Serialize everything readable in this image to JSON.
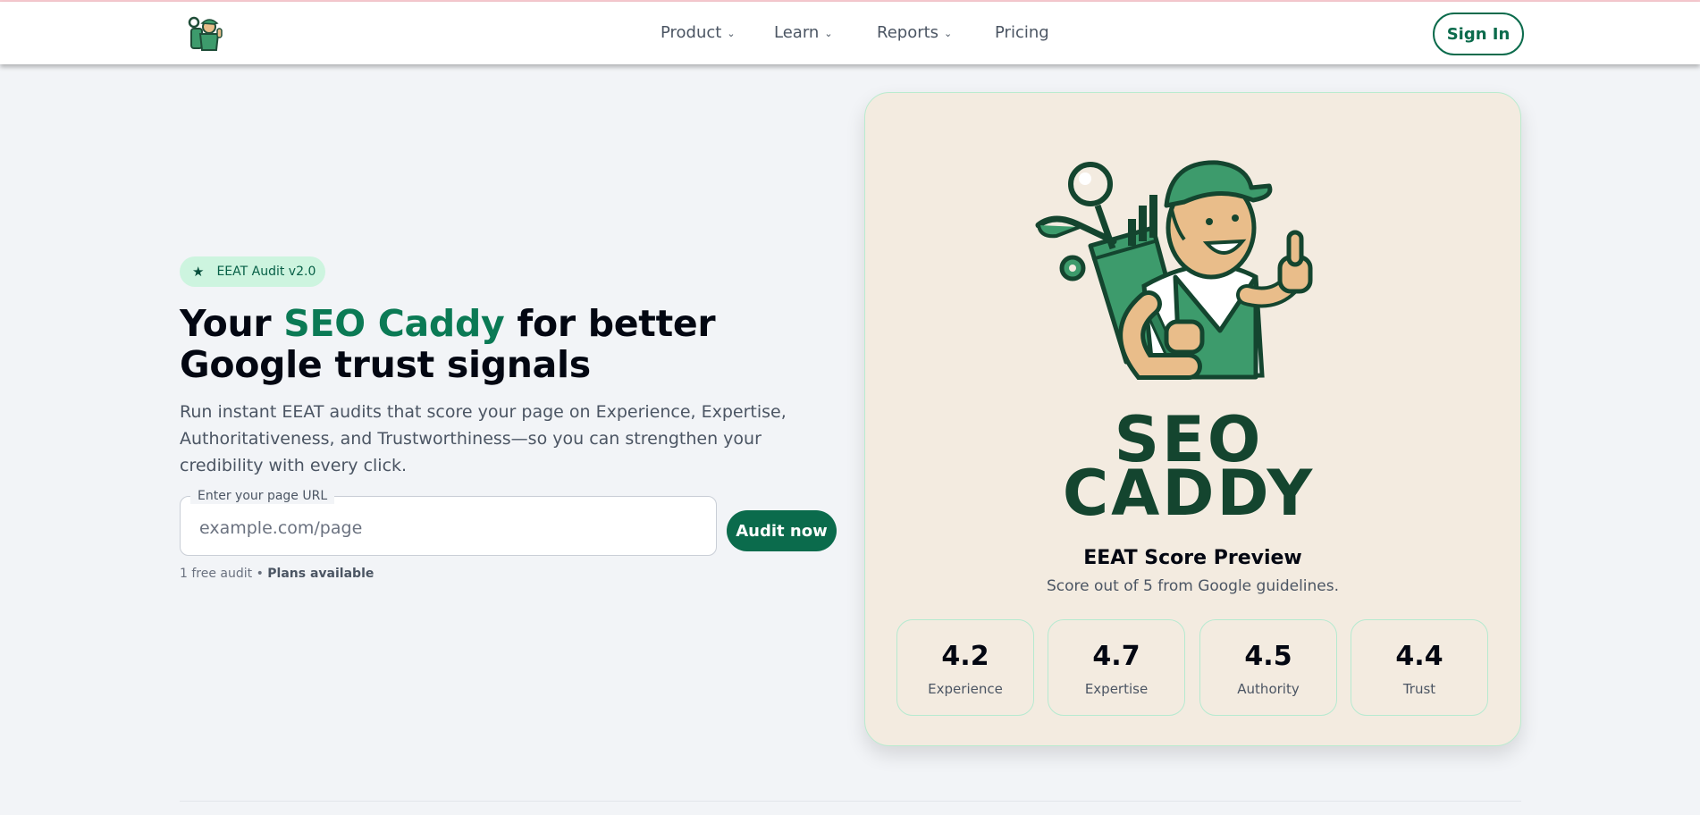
{
  "nav": {
    "items": [
      {
        "label": "Product",
        "has_dropdown": true
      },
      {
        "label": "Learn",
        "has_dropdown": true
      },
      {
        "label": "Reports",
        "has_dropdown": true
      },
      {
        "label": "Pricing",
        "has_dropdown": false
      }
    ],
    "sign_in": "Sign In"
  },
  "hero": {
    "badge": "EEAT Audit v2.0",
    "headline_pre": "Your ",
    "headline_accent": "SEO Caddy",
    "headline_post": " for better Google trust signals",
    "description": "Run instant EEAT audits that score your page on Experience, Expertise, Authoritativeness, and Trustworthiness—so you can strengthen your credibility with every click.",
    "url_label": "Enter your page URL",
    "url_placeholder": "example.com/page",
    "audit_button": "Audit now",
    "note_plain": "1 free audit • ",
    "note_bold": "Plans available"
  },
  "card": {
    "brand_line1": "SEO",
    "brand_line2": "CADDY",
    "title": "EEAT Score Preview",
    "subtitle": "Score out of 5 from Google guidelines.",
    "scores": [
      {
        "value": "4.2",
        "label": "Experience"
      },
      {
        "value": "4.7",
        "label": "Expertise"
      },
      {
        "value": "4.5",
        "label": "Authority"
      },
      {
        "value": "4.4",
        "label": "Trust"
      }
    ]
  },
  "colors": {
    "brand_green": "#0b6b4c",
    "accent_green": "#0b7a55",
    "badge_bg": "#cdf4df",
    "card_bg": "#f3ebe0",
    "page_bg": "#f2f4f7"
  }
}
